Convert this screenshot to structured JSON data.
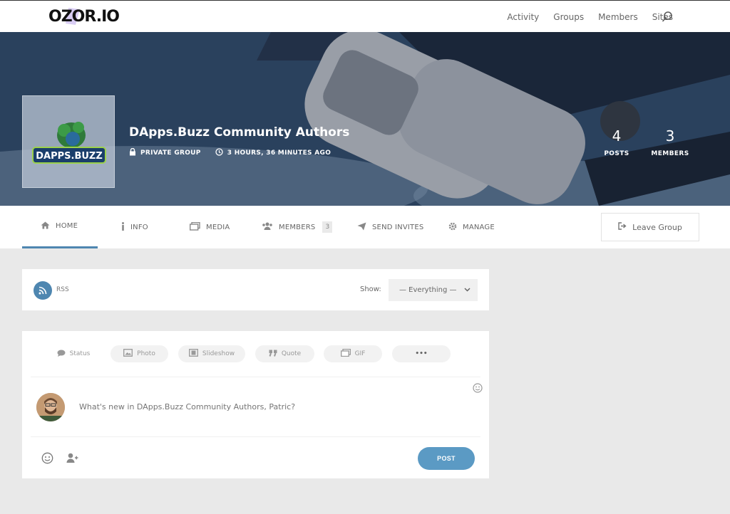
{
  "header": {
    "logo_text": "OZOR.IO",
    "nav": [
      "Activity",
      "Groups",
      "Members",
      "Sites"
    ]
  },
  "group": {
    "title": "DApps.Buzz Community Authors",
    "privacy": "PRIVATE GROUP",
    "active_time": "3 HOURS, 36 MINUTES AGO",
    "avatar_text": "DAPPS.BUZZ",
    "stats": {
      "posts_num": "4",
      "posts_label": "POSTS",
      "members_num": "3",
      "members_label": "MEMBERS"
    }
  },
  "tabs": {
    "home": "HOME",
    "info": "INFO",
    "media": "MEDIA",
    "members": "MEMBERS",
    "members_count": "3",
    "send_invites": "SEND INVITES",
    "manage": "MANAGE",
    "leave_group": "Leave Group"
  },
  "filter": {
    "rss": "RSS",
    "show_label": "Show:",
    "show_value": "— Everything —"
  },
  "post_form": {
    "types": {
      "status": "Status",
      "photo": "Photo",
      "slideshow": "Slideshow",
      "quote": "Quote",
      "gif": "GIF",
      "more": "•••"
    },
    "placeholder": "What's new in DApps.Buzz Community Authors, Patric?",
    "post_button": "POST"
  },
  "colors": {
    "accent": "#4e86b0",
    "post_button": "#5b9ac4",
    "page_bg": "#e9e9e9"
  }
}
